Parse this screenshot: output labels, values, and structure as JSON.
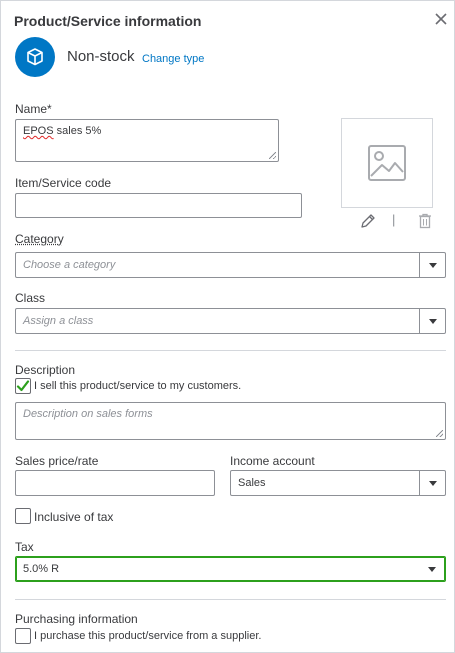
{
  "header": {
    "title": "Product/Service information",
    "close_icon": "close-icon"
  },
  "type": {
    "icon": "box-icon",
    "label": "Non-stock",
    "change_link": "Change type"
  },
  "name": {
    "label": "Name*",
    "value_word1": "EPOS",
    "value_rest": " sales 5%"
  },
  "item_code": {
    "label": "Item/Service code",
    "value": ""
  },
  "image": {
    "placeholder_icon": "image-placeholder-icon",
    "edit_icon": "pencil-icon",
    "separator": "|",
    "delete_icon": "trash-icon"
  },
  "category": {
    "label": "Category",
    "placeholder": "Choose a category"
  },
  "class": {
    "label": "Class",
    "placeholder": "Assign a class"
  },
  "description": {
    "label": "Description",
    "sell_checked": true,
    "sell_label": "I sell this product/service to my customers.",
    "placeholder": "Description on sales forms"
  },
  "sales_price": {
    "label": "Sales price/rate",
    "value": ""
  },
  "income_account": {
    "label": "Income account",
    "value": "Sales"
  },
  "inclusive_tax": {
    "checked": false,
    "label": "Inclusive of tax"
  },
  "tax": {
    "label": "Tax",
    "value": "5.0% R"
  },
  "purchasing": {
    "label": "Purchasing information",
    "checked": false,
    "purchase_label": "I purchase this product/service from a supplier."
  },
  "colors": {
    "accent_blue": "#0077c5",
    "focus_green": "#2ca01c",
    "check_green": "#2ca01c"
  }
}
